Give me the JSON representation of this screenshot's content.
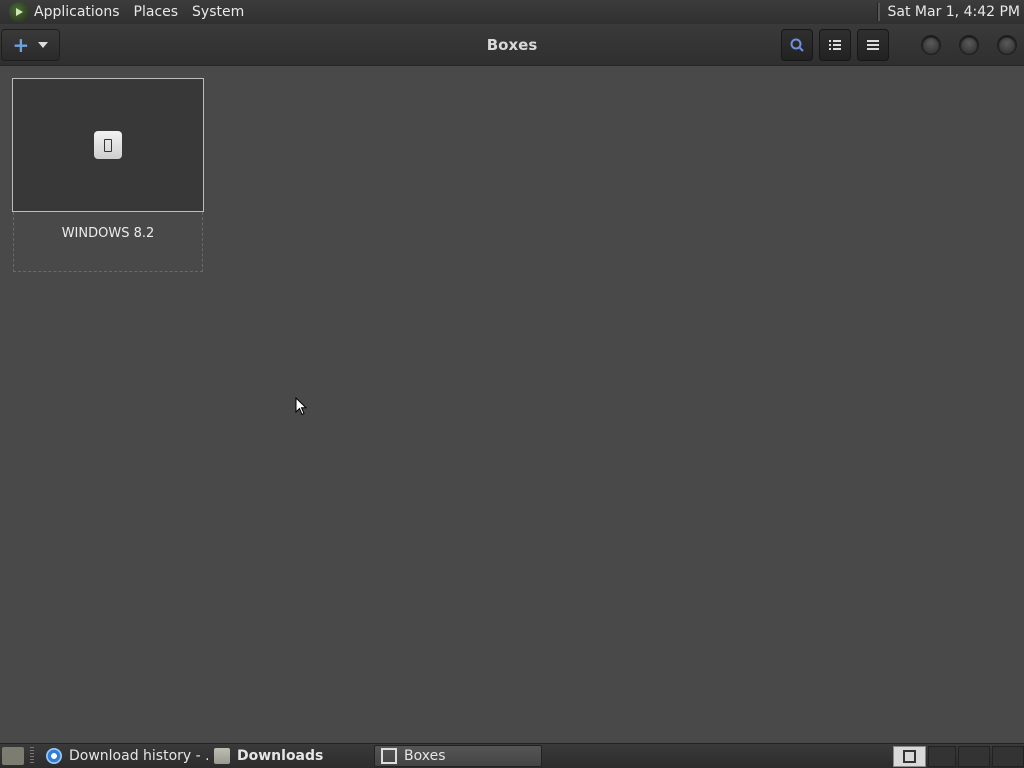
{
  "top_panel": {
    "menus": [
      "Applications",
      "Places",
      "System"
    ],
    "clock": "Sat Mar  1,  4:42 PM"
  },
  "header": {
    "title": "Boxes",
    "new_button_icon": "plus-icon",
    "buttons": [
      "search-icon",
      "list-view-icon",
      "menu-icon"
    ],
    "accent": "#6fa0e0"
  },
  "boxes": [
    {
      "name": "WINDOWS 8.2",
      "icon": "machine-icon"
    }
  ],
  "taskbar": {
    "tasks": [
      {
        "label": "Download history - ...",
        "icon": "browser-icon"
      },
      {
        "label": "Downloads",
        "icon": "folder-icon"
      },
      {
        "label": "Boxes",
        "icon": "boxes-icon",
        "active": true
      }
    ]
  }
}
